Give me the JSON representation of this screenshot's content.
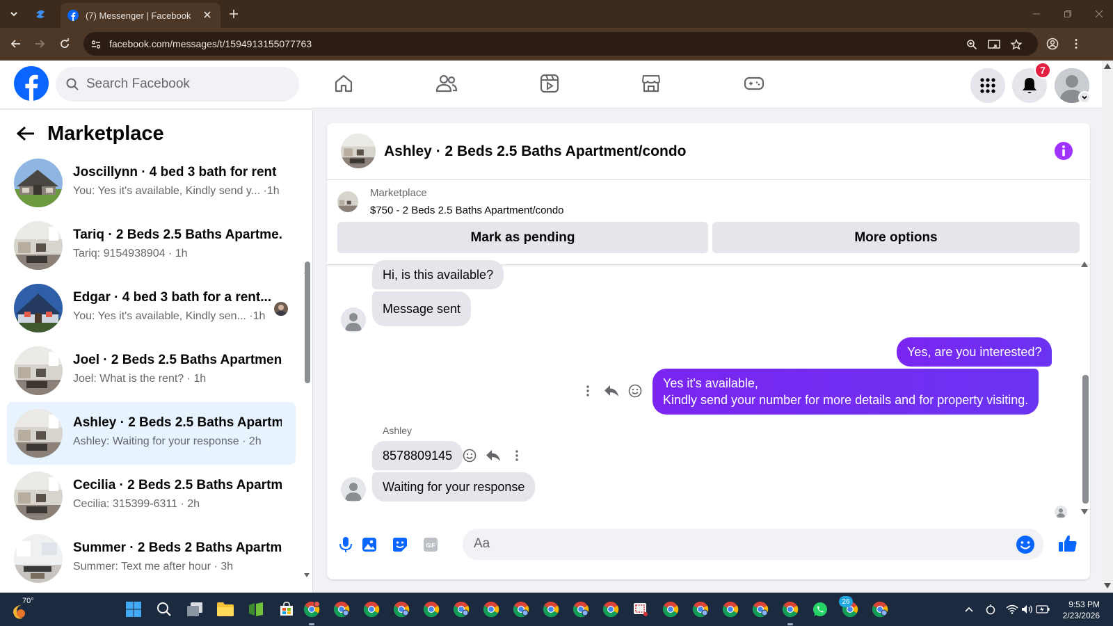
{
  "browser": {
    "tab_title": "(7) Messenger | Facebook",
    "url": "facebook.com/messages/t/1594913155077763"
  },
  "header": {
    "search_placeholder": "Search Facebook",
    "notification_count": "7"
  },
  "left_panel": {
    "title": "Marketplace",
    "conversations": [
      {
        "name": "Joscillynn · 4 bed 3 bath for rent",
        "preview": "You: Yes it's available, Kindly send y...",
        "time": " ·1h",
        "avatar": "house-stone",
        "active": false
      },
      {
        "name": "Tariq · 2 Beds 2.5 Baths Apartme...",
        "preview": "Tariq: 9154938904",
        "time": " · 1h",
        "avatar": "apartment",
        "active": false
      },
      {
        "name": "Edgar · 4 bed 3 bath for a rent...",
        "preview": "You: Yes it's available, Kindly sen...",
        "time": " ·1h",
        "avatar": "house-blue",
        "active": false
      },
      {
        "name": "Joel · 2 Beds 2.5 Baths Apartmen...",
        "preview": "Joel: What is the rent?",
        "time": " · 1h",
        "avatar": "apartment",
        "active": false
      },
      {
        "name": "Ashley · 2 Beds 2.5 Baths Apartm...",
        "preview": "Ashley: Waiting for your response",
        "time": " · 2h",
        "avatar": "apartment",
        "active": true
      },
      {
        "name": "Cecilia · 2 Beds 2.5 Baths Apartm...",
        "preview": "Cecilia: 315399-6311",
        "time": " · 2h",
        "avatar": "apartment",
        "active": false
      },
      {
        "name": "Summer · 2 Beds 2 Baths Apartm...",
        "preview": "Summer: Text me after hour",
        "time": " · 3h",
        "avatar": "apartment-bright",
        "active": false
      }
    ]
  },
  "chat": {
    "title": "Ashley · 2 Beds 2.5 Baths Apartment/condo",
    "listing_source": "Marketplace",
    "listing_title": "$750 - 2 Beds 2.5 Baths Apartment/condo",
    "mark_pending_label": "Mark as pending",
    "more_options_label": "More options",
    "messages": {
      "m1": "Hi, is this available?",
      "m2": "Message sent",
      "m3": "Yes, are you interested?",
      "m4_line1": "Yes it's available,",
      "m4_line2": "Kindly send your number for more details and for property visiting.",
      "sender_name": "Ashley",
      "m5": "8578809145",
      "m6": "Waiting for your response"
    },
    "composer_placeholder": "Aa"
  },
  "taskbar": {
    "temperature": "70°",
    "time": "9:53 PM",
    "date": "2/23/2026",
    "whatsapp_badge": "26"
  },
  "colors": {
    "fb_blue": "#0866ff",
    "outgoing_bubble": "#7a26f0",
    "incoming_bubble": "#e4e6eb",
    "active_row": "#e7f3ff",
    "badge_red": "#e41e3f"
  }
}
